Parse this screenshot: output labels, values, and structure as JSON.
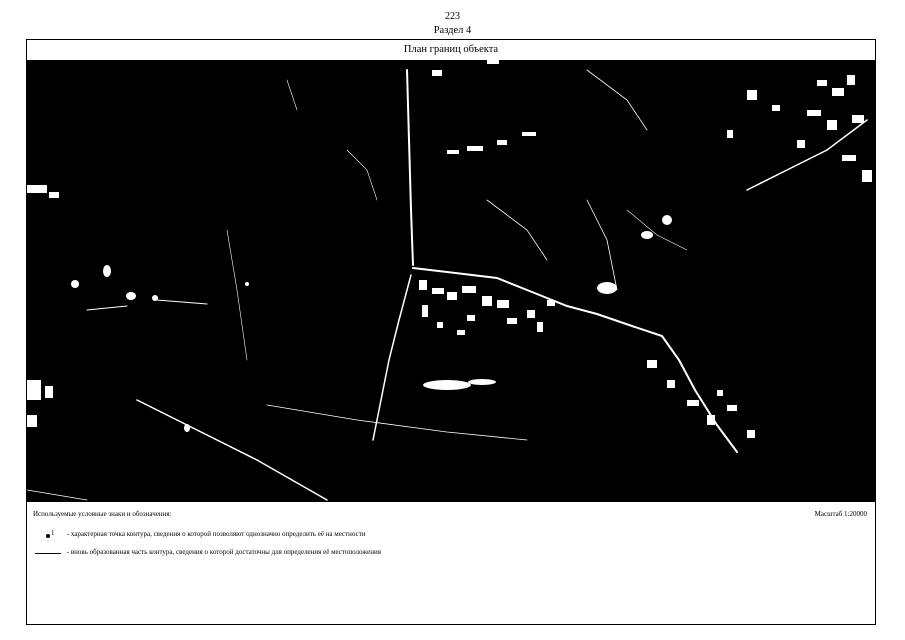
{
  "page": {
    "number": "223",
    "section": "Раздел 4"
  },
  "plan": {
    "title": "План границ объекта",
    "map": {
      "background": "#000000",
      "feature_color": "#ffffff",
      "content": "satellite-image-thresholded"
    }
  },
  "legend": {
    "header": "Используемые условные знаки и обозначения:",
    "scale": "Масштаб 1:20000",
    "items": [
      {
        "symbol_label": "1",
        "text": "- характерная точка контура, сведения о которой позволяют однозначно определить её на местности"
      },
      {
        "text": "- вновь образованная часть контура, сведения о которой достаточны для определения её местоположения"
      }
    ]
  }
}
